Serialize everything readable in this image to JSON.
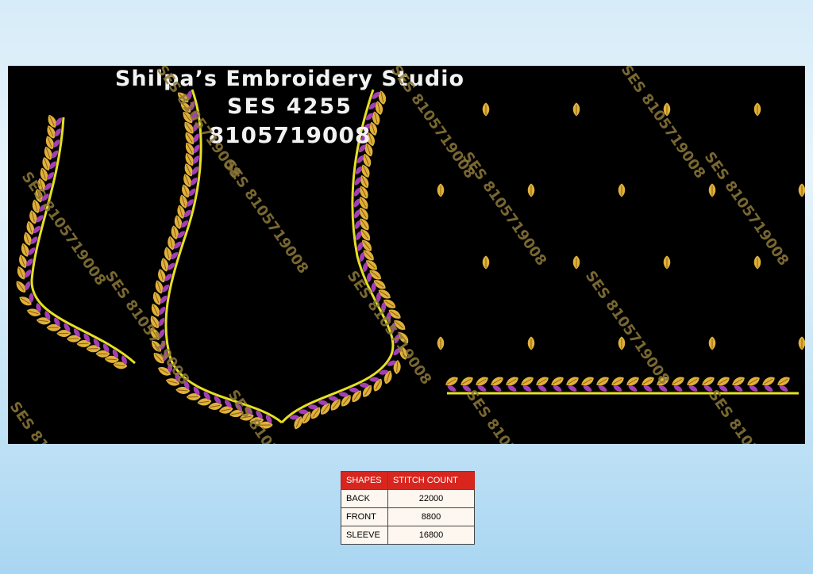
{
  "header": {
    "studio_name": "Shilpa’s Embroidery Studio",
    "design_code": "SES 4255",
    "phone": "8105719008"
  },
  "watermark_text": "SES 8105719008",
  "colors": {
    "background_top": "#d6ecf8",
    "background_bottom": "#a9d6f2",
    "panel": "#000000",
    "border_line": "#e6e024",
    "leaf_gold": "#e0b13a",
    "leaf_purple": "#a23fb5",
    "watermark": "#8d7a3a",
    "table_header": "#d8261f"
  },
  "stitch_table": {
    "headers": [
      "SHAPES",
      "STITCH COUNT"
    ],
    "rows": [
      {
        "shape": "BACK",
        "count": "22000"
      },
      {
        "shape": "FRONT",
        "count": "8800"
      },
      {
        "shape": "SLEEVE",
        "count": "16800"
      }
    ]
  }
}
